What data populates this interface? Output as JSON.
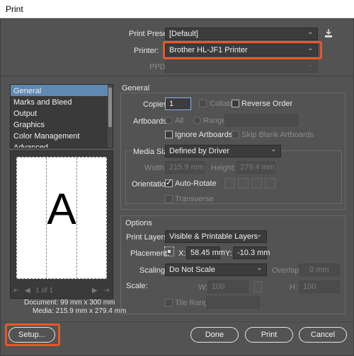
{
  "window": {
    "title": "Print"
  },
  "print_preset": {
    "label": "Print Preset:",
    "value": "[Default]"
  },
  "printer": {
    "label": "Printer:",
    "value": "Brother HL-JF1 Printer"
  },
  "ppd": {
    "label": "PPD:",
    "value": ""
  },
  "categories": [
    "General",
    "Marks and Bleed",
    "Output",
    "Graphics",
    "Color Management",
    "Advanced"
  ],
  "selected_category": "General",
  "general": {
    "heading": "General",
    "copies_label": "Copies:",
    "copies_value": "1",
    "collate_label": "Collate",
    "reverse_order_label": "Reverse Order",
    "artboards_label": "Artboards:",
    "all_label": "All",
    "range_label": "Range:",
    "ignore_artboards_label": "Ignore Artboards",
    "skip_blank_label": "Skip Blank Artboards",
    "media_size_label": "Media Size:",
    "media_size_value": "Defined by Driver",
    "width_label": "Width:",
    "width_value": "215.9 mm",
    "height_label": "Height:",
    "height_value": "279.4 mm",
    "orientation_label": "Orientation:",
    "auto_rotate_label": "Auto-Rotate",
    "transverse_label": "Transverse"
  },
  "options": {
    "heading": "Options",
    "print_layers_label": "Print Layers:",
    "print_layers_value": "Visible & Printable Layers",
    "placement_label": "Placement:",
    "x_label": "X:",
    "x_value": "58.45 mm",
    "y_label": "Y:",
    "y_value": "-10.3 mm",
    "scaling_label": "Scaling:",
    "scaling_value": "Do Not Scale",
    "overlap_label": "Overlap:",
    "overlap_value": "0 mm",
    "scale_label": "Scale:",
    "w_label": "W:",
    "w_value": "100",
    "h_label": "H:",
    "h_value": "100",
    "tile_range_label": "Tile Range:"
  },
  "preview": {
    "letter": "A",
    "page_counter": "1 of 1",
    "document_info": "Document: 99 mm x 300 mm",
    "media_info": "Media: 215.9 mm x 279.4 mm"
  },
  "buttons": {
    "setup": "Setup...",
    "done": "Done",
    "print": "Print",
    "cancel": "Cancel"
  },
  "colors": {
    "accent_highlight": "#e8572a",
    "selection": "#5f88b3",
    "background": "#535353"
  }
}
